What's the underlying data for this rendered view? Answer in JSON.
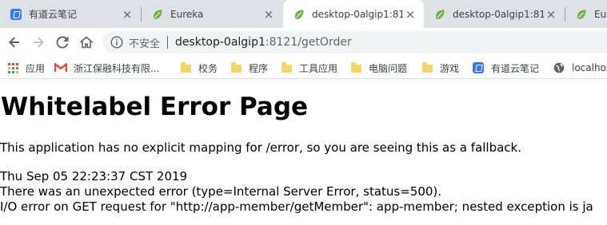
{
  "browser": {
    "tabs": [
      {
        "title": "有道云笔记",
        "icon": "youdao-note-icon",
        "active": false
      },
      {
        "title": "Eureka",
        "icon": "spring-leaf-icon",
        "active": false
      },
      {
        "title": "desktop-0algip1:81",
        "icon": "spring-leaf-icon",
        "active": true
      },
      {
        "title": "desktop-0algip1:81",
        "icon": "spring-leaf-icon",
        "active": false
      },
      {
        "title": "Eure",
        "icon": "spring-leaf-icon",
        "active": false
      }
    ],
    "tab_close_glyph": "×",
    "address_bar": {
      "security_label": "不安全",
      "url_host": "desktop-0algip1",
      "url_rest": ":8121/getOrder"
    },
    "bookmarks": [
      {
        "label": "应用",
        "icon": "apps-grid-icon"
      },
      {
        "label": "浙江保融科技有限...",
        "icon": "gmail-icon"
      },
      {
        "label": "校务",
        "icon": "folder-icon"
      },
      {
        "label": "程序",
        "icon": "folder-icon"
      },
      {
        "label": "工具应用",
        "icon": "folder-icon"
      },
      {
        "label": "电脑问题",
        "icon": "folder-icon"
      },
      {
        "label": "游戏",
        "icon": "folder-icon"
      },
      {
        "label": "有道云笔记",
        "icon": "youdao-note-icon"
      },
      {
        "label": "localhos",
        "icon": "globe-icon"
      }
    ],
    "colors": {
      "tabstrip": "#dee1e6",
      "omnibox": "#f1f3f4",
      "spring_green": "#6db33f",
      "youdao_blue": "#3478f6",
      "folder_yellow": "#f8d463",
      "gmail_red": "#ea4335"
    }
  },
  "page": {
    "heading": "Whitelabel Error Page",
    "message": "This application has no explicit mapping for /error, so you are seeing this as a fallback.",
    "timestamp": "Thu Sep 05 22:23:37 CST 2019",
    "error_summary": "There was an unexpected error (type=Internal Server Error, status=500).",
    "error_detail": "I/O error on GET request for \"http://app-member/getMember\": app-member; nested exception is ja"
  }
}
